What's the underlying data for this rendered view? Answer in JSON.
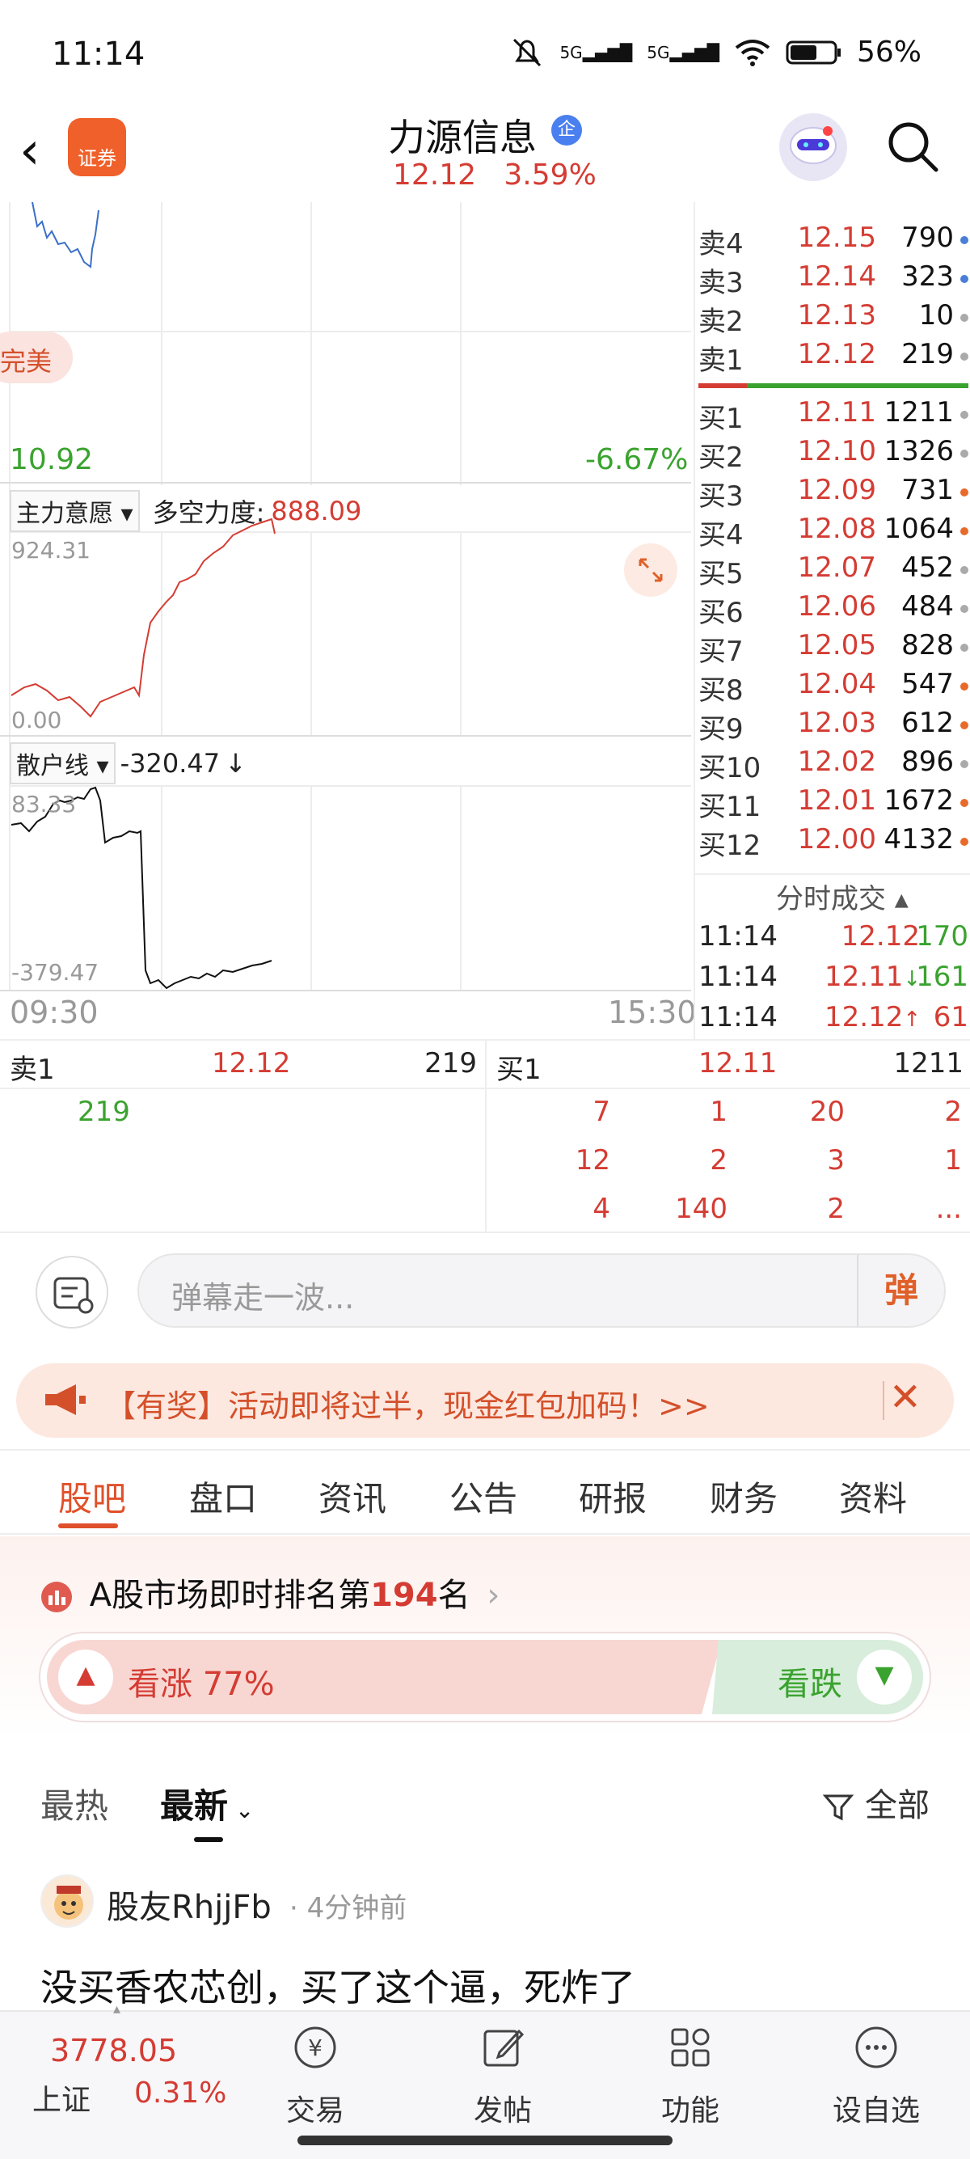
{
  "status_bar": {
    "time": "11:14",
    "network1": "5G",
    "network2": "5G",
    "battery": "56%"
  },
  "header": {
    "stock_name": "力源信息",
    "badge": "企",
    "logo_text": "证券",
    "price": "12.12",
    "change_pct": "3.59%"
  },
  "chart": {
    "left_label": "完美",
    "low_price": "10.92",
    "low_pct": "-6.67%",
    "indicator1": {
      "selector": "主力意愿",
      "name_label": "多空力度:",
      "value": "888.09",
      "top": "924.31",
      "bottom": "0.00"
    },
    "indicator2": {
      "selector": "散户线",
      "value": "-320.47",
      "arrow": "↓",
      "top": "83.33",
      "bottom": "-379.47"
    },
    "time_start": "09:30",
    "time_end": "15:30"
  },
  "order_book": {
    "asks": [
      {
        "label": "卖4",
        "price": "12.15",
        "volume": "790",
        "dot": "blue"
      },
      {
        "label": "卖3",
        "price": "12.14",
        "volume": "323",
        "dot": "blue"
      },
      {
        "label": "卖2",
        "price": "12.13",
        "volume": "10",
        "dot": "gray"
      },
      {
        "label": "卖1",
        "price": "12.12",
        "volume": "219",
        "dot": "gray"
      }
    ],
    "bids": [
      {
        "label": "买1",
        "price": "12.11",
        "volume": "1211",
        "dot": "gray"
      },
      {
        "label": "买2",
        "price": "12.10",
        "volume": "1326",
        "dot": "gray"
      },
      {
        "label": "买3",
        "price": "12.09",
        "volume": "731",
        "dot": "orange"
      },
      {
        "label": "买4",
        "price": "12.08",
        "volume": "1064",
        "dot": "orange"
      },
      {
        "label": "买5",
        "price": "12.07",
        "volume": "452",
        "dot": "gray"
      },
      {
        "label": "买6",
        "price": "12.06",
        "volume": "484",
        "dot": "gray"
      },
      {
        "label": "买7",
        "price": "12.05",
        "volume": "828",
        "dot": "gray"
      },
      {
        "label": "买8",
        "price": "12.04",
        "volume": "547",
        "dot": "orange"
      },
      {
        "label": "买9",
        "price": "12.03",
        "volume": "612",
        "dot": "orange"
      },
      {
        "label": "买10",
        "price": "12.02",
        "volume": "896",
        "dot": "gray"
      },
      {
        "label": "买11",
        "price": "12.01",
        "volume": "1672",
        "dot": "orange"
      },
      {
        "label": "买12",
        "price": "12.00",
        "volume": "4132",
        "dot": "orange"
      }
    ],
    "trades_title": "分时成交",
    "trades": [
      {
        "time": "11:14",
        "price": "12.12",
        "arrow": "",
        "volume": "170",
        "vol_color": "green"
      },
      {
        "time": "11:14",
        "price": "12.11",
        "arrow": "↓",
        "volume": "161",
        "vol_color": "green"
      },
      {
        "time": "11:14",
        "price": "12.12",
        "arrow": "↑",
        "volume": "61",
        "vol_color": "red"
      }
    ]
  },
  "queue": {
    "sell_label": "卖1",
    "sell_price": "12.12",
    "sell_volume": "219",
    "buy_label": "买1",
    "buy_price": "12.11",
    "buy_volume": "1211",
    "sell_orders": [
      "219"
    ],
    "buy_orders": [
      [
        "7",
        "1",
        "20",
        "2"
      ],
      [
        "12",
        "2",
        "3",
        "1"
      ],
      [
        "4",
        "140",
        "2",
        "..."
      ]
    ]
  },
  "danmu": {
    "placeholder": "弹幕走一波...",
    "button": "弹"
  },
  "promo": {
    "text": "【有奖】活动即将过半，现金红包加码！>>"
  },
  "tabs": [
    "股吧",
    "盘口",
    "资讯",
    "公告",
    "研报",
    "财务",
    "资料"
  ],
  "rank": {
    "prefix": "A股市场即时排名第",
    "number": "194",
    "suffix": "名"
  },
  "sentiment": {
    "up_label": "看涨",
    "up_pct": "77%",
    "up_value": 0.77,
    "down_label": "看跌"
  },
  "feed": {
    "tab_hot": "最热",
    "tab_new": "最新",
    "filter": "全部"
  },
  "post": {
    "user": "股友RhjjFb",
    "time": "4分钟前",
    "content": "没买香农芯创，买了这个逼，死炸了"
  },
  "bottom_nav": {
    "index_value": "3778.05",
    "index_name": "上证",
    "index_pct": "0.31%",
    "items": [
      "交易",
      "发帖",
      "功能",
      "设自选"
    ]
  }
}
